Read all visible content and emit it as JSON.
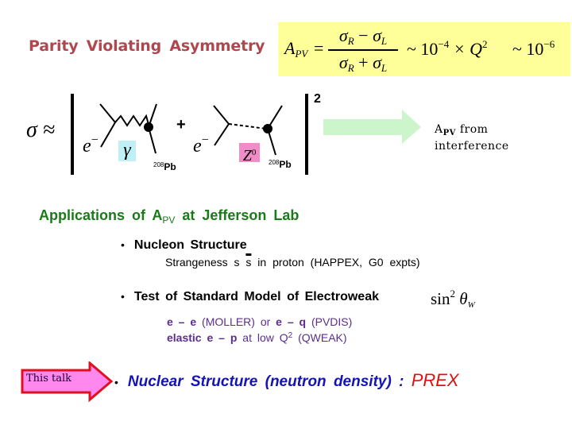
{
  "title": "Parity  Violating  Asymmetry",
  "formula": {
    "lhs": "A",
    "lhs_sub": "PV",
    "equals": "=",
    "num_a": "σ",
    "num_a_sub": "R",
    "num_op": " − ",
    "num_b": "σ",
    "num_b_sub": "L",
    "den_a": "σ",
    "den_a_sub": "R",
    "den_op": " + ",
    "den_b": "σ",
    "den_b_sub": "L",
    "approx1": "~ 10",
    "approx1_exp": "−4",
    "times": " × Q",
    "q_exp": "2",
    "approx2": "~ 10",
    "approx2_exp": "−6",
    "background_color": "#ffff99"
  },
  "diagram": {
    "sigma_approx": "σ ≈",
    "plus": "+",
    "squared": "2",
    "electron_label": "e",
    "electron_charge": "−",
    "photon_label": "γ",
    "z_label": "Z",
    "z_sup": "0",
    "nucleus_mass": "208",
    "nucleus_symbol": "Pb",
    "arrow_color": "#ccf5cc",
    "result_line1": "A",
    "result_line1_sub": "PV",
    "result_line1_rest": "  from",
    "result_line2": "interference"
  },
  "applications": {
    "heading_pre": "Applications  of  A",
    "heading_sub": "PV",
    "heading_post": " at  Jefferson  Lab",
    "bullet": "•",
    "items": [
      {
        "label": "Nucleon  Structure",
        "detail_pre": "Strangeness  s",
        "detail_bar": "s",
        "detail_post": "  in  proton   (HAPPEX,  G0  expts)"
      },
      {
        "label": "Test  of   Standard  Model  of  Electroweak",
        "formula": "sin",
        "formula_exp": "2",
        "formula_theta": "θ",
        "formula_sub": "W",
        "lines": [
          {
            "b1": "e – e",
            "t1": "   (MOLLER)    or ",
            "b2": "e – q",
            "t2": "  (PVDIS)"
          },
          {
            "b1": "elastic  e – p",
            "t1": "  at  low  Q",
            "sup": "2",
            "t2": "   (QWEAK)"
          }
        ]
      },
      {
        "label": "Nuclear  Structure  (neutron  density)  : ",
        "highlight": "PREX",
        "callout": "This talk"
      }
    ]
  }
}
